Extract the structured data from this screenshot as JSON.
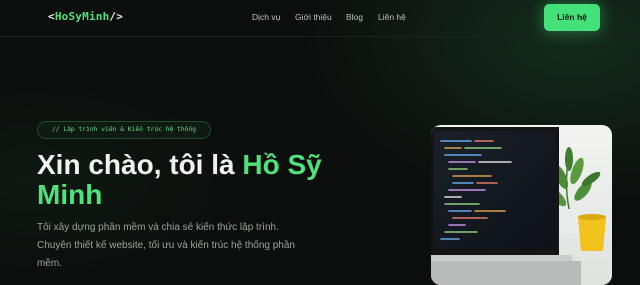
{
  "header": {
    "logo": {
      "prefix": "<",
      "name": "HoSyMinh",
      "suffix": "/>"
    },
    "nav": [
      "Dịch vụ",
      "Giới thiệu",
      "Blog",
      "Liên hệ"
    ],
    "cta_label": "Liên hệ"
  },
  "hero": {
    "tag": "// Lập trình viên & Kiến trúc hệ thống",
    "title_plain": "Xin chào, tôi là ",
    "title_highlight": "Hồ Sỹ Minh",
    "description": "Tôi xây dựng phần mềm và chia sẻ kiến thức lập trình. Chuyên thiết kế website, tối ưu và kiến trúc hệ thống phần mềm."
  },
  "colors": {
    "background": "#0c0e0d",
    "accent": "#44e07a",
    "text": "#f1f3f1",
    "muted": "#98a49c"
  },
  "image": {
    "icon": "laptop-with-code-photo"
  }
}
